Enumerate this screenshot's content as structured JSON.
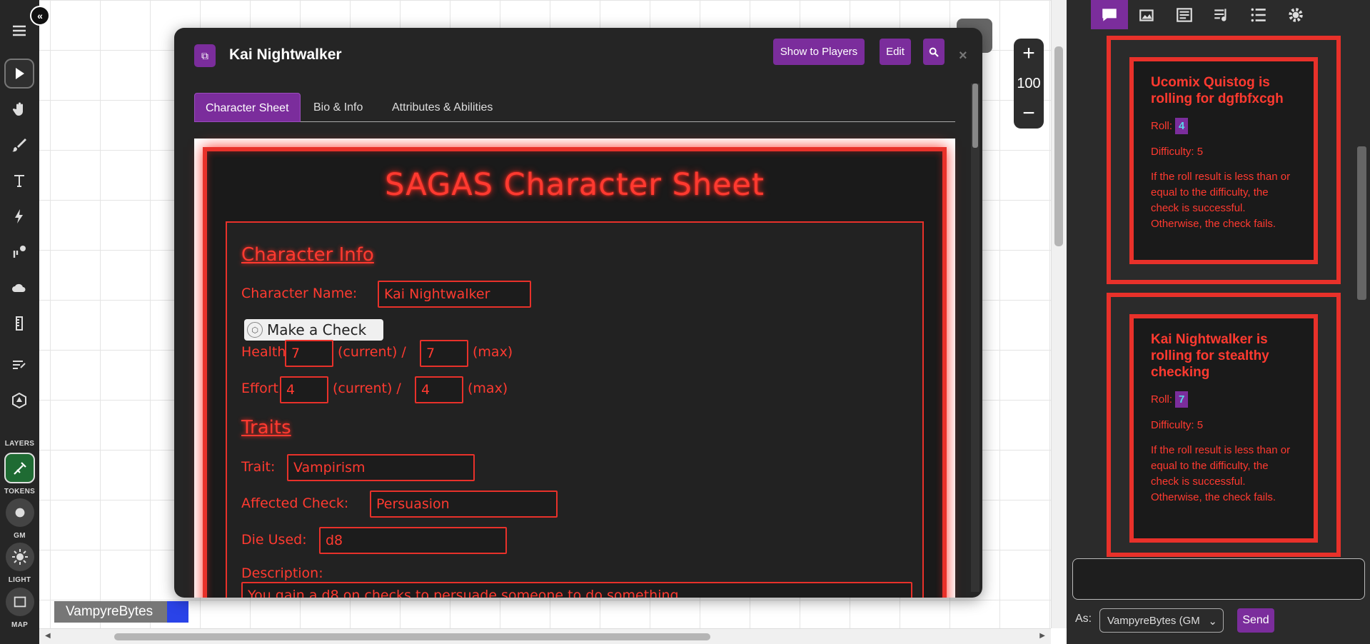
{
  "toolbar": {
    "labels": {
      "layers": "LAYERS",
      "tokens": "TOKENS",
      "gm": "GM",
      "light": "LIGHT",
      "map": "MAP"
    }
  },
  "player": {
    "name": "VampyreBytes",
    "color": "#2a43e8"
  },
  "zoom": {
    "value": "100",
    "plus": "+",
    "minus": "−"
  },
  "dialog": {
    "title": "Kai Nightwalker",
    "buttons": {
      "show": "Show to Players",
      "edit": "Edit",
      "close": "×"
    },
    "tabs": [
      "Character Sheet",
      "Bio & Info",
      "Attributes & Abilities"
    ],
    "active_tab": "Character Sheet"
  },
  "sheet": {
    "title": "SAGAS Character Sheet",
    "info_heading": "Character Info",
    "name_label": "Character Name:",
    "name_value": "Kai Nightwalker",
    "check_button": "Make a Check",
    "health_label": "Health:",
    "health_current": "7",
    "health_max": "7",
    "current_label": "(current) /",
    "max_label": "(max)",
    "effort_label": "Effort:",
    "effort_current": "4",
    "effort_max": "4",
    "traits_heading": "Traits",
    "trait_label": "Trait:",
    "trait_value": "Vampirism",
    "affected_label": "Affected Check:",
    "affected_value": "Persuasion",
    "die_label": "Die Used:",
    "die_value": "d8",
    "desc_label": "Description:",
    "desc_value": "You gain a d8 on checks to persuade someone to do something"
  },
  "chat": {
    "messages": [
      {
        "title": "Ucomix Quistog is rolling for dgfbfxcgh",
        "roll_label": "Roll:",
        "roll": "4",
        "difficulty": "Difficulty: 5",
        "desc": "If the roll result is less than or equal to the difficulty, the check is successful. Otherwise, the check fails."
      },
      {
        "title": "Kai Nightwalker is rolling for stealthy checking",
        "roll_label": "Roll:",
        "roll": "7",
        "difficulty": "Difficulty: 5",
        "desc": "If the roll result is less than or equal to the difficulty, the check is successful. Otherwise, the check fails."
      }
    ],
    "as_label": "As:",
    "as_value": "VampyreBytes (GM",
    "send": "Send"
  },
  "colors": {
    "accent": "#7b2d9c",
    "neon_red": "#ff3a30",
    "panel": "#252525"
  }
}
